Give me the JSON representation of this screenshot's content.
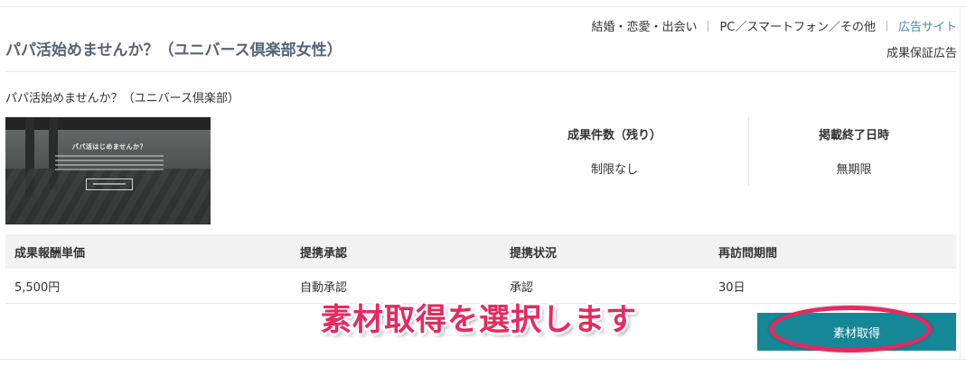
{
  "header": {
    "title": "パパ活始めませんか？（ユニバース倶楽部女性）",
    "categories": [
      "結婚・恋愛・出会い",
      "PC／スマートフォン／その他"
    ],
    "site_link": "広告サイト",
    "guarantee": "成果保証広告"
  },
  "program": {
    "subtitle": "パパ活始めませんか？（ユニバース倶楽部）",
    "banner_text": "パパ活はじめませんか？",
    "stats": [
      {
        "label": "成果件数（残り）",
        "value": "制限なし"
      },
      {
        "label": "掲載終了日時",
        "value": "無期限"
      }
    ]
  },
  "table": {
    "headers": [
      "成果報酬単価",
      "提携承認",
      "提携状況",
      "再訪問期間"
    ],
    "row": [
      "5,500円",
      "自動承認",
      "承認",
      "30日"
    ]
  },
  "annotation": {
    "callout": "素材取得を選択します",
    "color": "#e8285e"
  },
  "actions": {
    "download_label": "素材取得",
    "button_color": "#168796"
  }
}
